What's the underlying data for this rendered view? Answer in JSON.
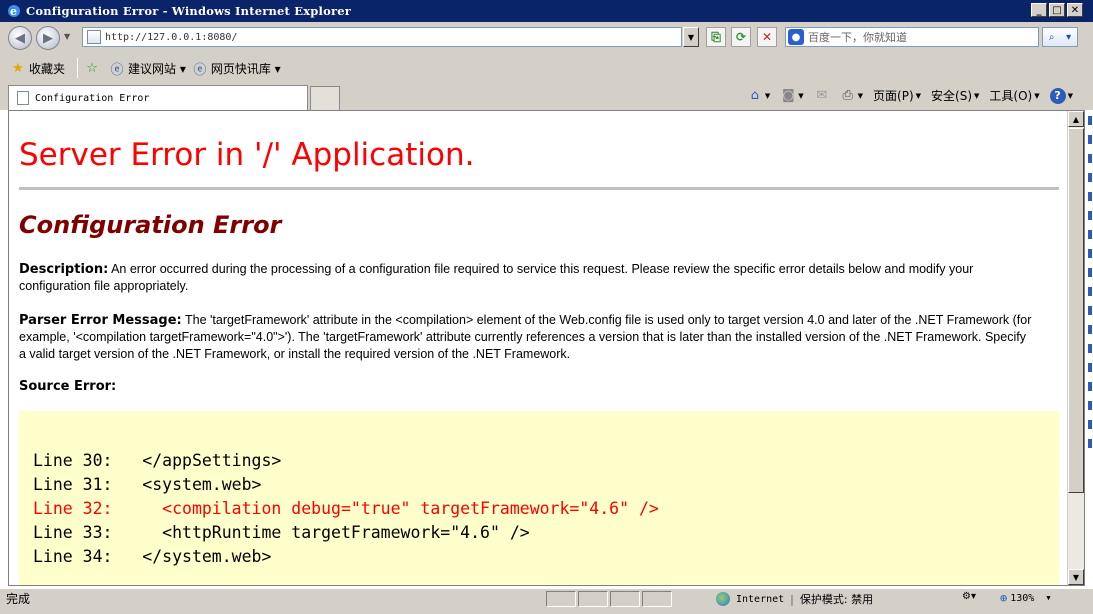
{
  "window": {
    "title": "Configuration Error - Windows Internet Explorer",
    "min_label": "_",
    "max_label": "□",
    "close_label": "✕"
  },
  "nav": {
    "back_icon": "◀",
    "forward_icon": "▶",
    "url": "http://127.0.0.1:8080/",
    "search_placeholder": "百度一下，你就知道",
    "search_icon": "🔍"
  },
  "favorites": {
    "favorites_label": "收藏夹",
    "items": [
      {
        "label": "建议网站 ▾"
      },
      {
        "label": "网页快讯库 ▾"
      }
    ]
  },
  "tabs": {
    "active_label": "Configuration Error"
  },
  "commandbar": {
    "page_label": "页面(P)",
    "safety_label": "安全(S)",
    "tools_label": "工具(O)",
    "help_icon": "?"
  },
  "page": {
    "h1": "Server Error in '/' Application.",
    "h2": "Configuration Error",
    "description_label": "Description:",
    "description_text": " An error occurred during the processing of a configuration file required to service this request. Please review the specific error details below and modify your configuration file appropriately.",
    "parser_label": "Parser Error Message:",
    "parser_text": " The 'targetFramework' attribute in the <compilation> element of the Web.config file is used only to target version 4.0 and later of the .NET Framework (for example, '<compilation targetFramework=\"4.0\">'). The 'targetFramework' attribute currently references a version that is later than the installed version of the .NET Framework. Specify a valid target version of the .NET Framework, or install the required version of the .NET Framework.",
    "source_label": "Source Error:",
    "code_lines": [
      "Line 30:   </appSettings>",
      "Line 31:   <system.web>",
      "Line 32:     <compilation debug=\"true\" targetFramework=\"4.6\" />",
      "Line 33:     <httpRuntime targetFramework=\"4.6\" />",
      "Line 34:   </system.web>"
    ],
    "error_line_index": 2
  },
  "status": {
    "text": "完成",
    "zone": "Internet",
    "protected_mode": "保护模式: 禁用",
    "zoom": "130%"
  },
  "colors": {
    "error_red": "#ff0000",
    "h2_maroon": "#800000",
    "code_bg": "#ffffcc"
  }
}
